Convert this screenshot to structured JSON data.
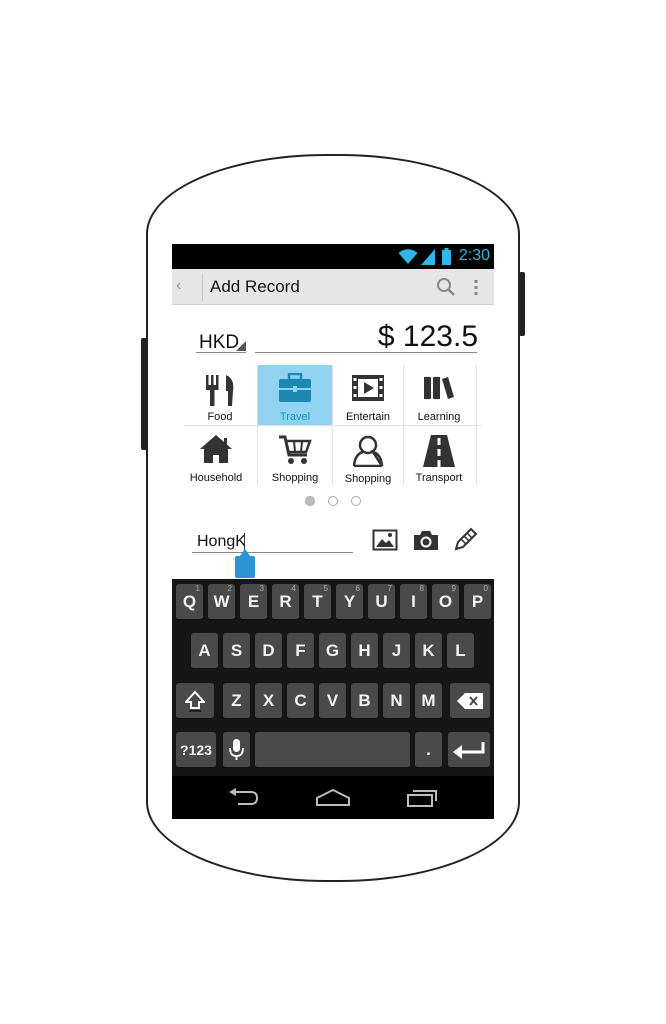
{
  "status_bar": {
    "time": "2:30"
  },
  "action_bar": {
    "title": "Add Record"
  },
  "entry": {
    "currency": "HKD",
    "amount": "$ 123.5"
  },
  "categories": [
    {
      "label": "Food",
      "icon": "fork-knife-icon",
      "selected": false
    },
    {
      "label": "Travel",
      "icon": "suitcase-icon",
      "selected": true
    },
    {
      "label": "Entertain",
      "icon": "film-icon",
      "selected": false
    },
    {
      "label": "Learning",
      "icon": "books-icon",
      "selected": false
    },
    {
      "label": "Household",
      "icon": "house-icon",
      "selected": false
    },
    {
      "label": "Shopping",
      "icon": "cart-icon",
      "selected": false
    },
    {
      "label": "Shopping",
      "icon": "person-icon",
      "selected": false
    },
    {
      "label": "Transport",
      "icon": "road-icon",
      "selected": false
    }
  ],
  "pager": {
    "pages": 3,
    "current": 1
  },
  "note": {
    "value": "HongK"
  },
  "keyboard": {
    "row1": [
      "Q",
      "W",
      "E",
      "R",
      "T",
      "Y",
      "U",
      "I",
      "O",
      "P"
    ],
    "row1_hints": [
      "1",
      "2",
      "3",
      "4",
      "5",
      "6",
      "7",
      "8",
      "9",
      "0"
    ],
    "row2": [
      "A",
      "S",
      "D",
      "F",
      "G",
      "H",
      "J",
      "K",
      "L"
    ],
    "row3": [
      "Z",
      "X",
      "C",
      "V",
      "B",
      "N",
      "M"
    ],
    "symbols_key": "?123",
    "period_key": "."
  },
  "colors": {
    "accent": "#33b5e5",
    "selected_bg": "#8fd3f0",
    "keyboard_bg": "#161616"
  }
}
